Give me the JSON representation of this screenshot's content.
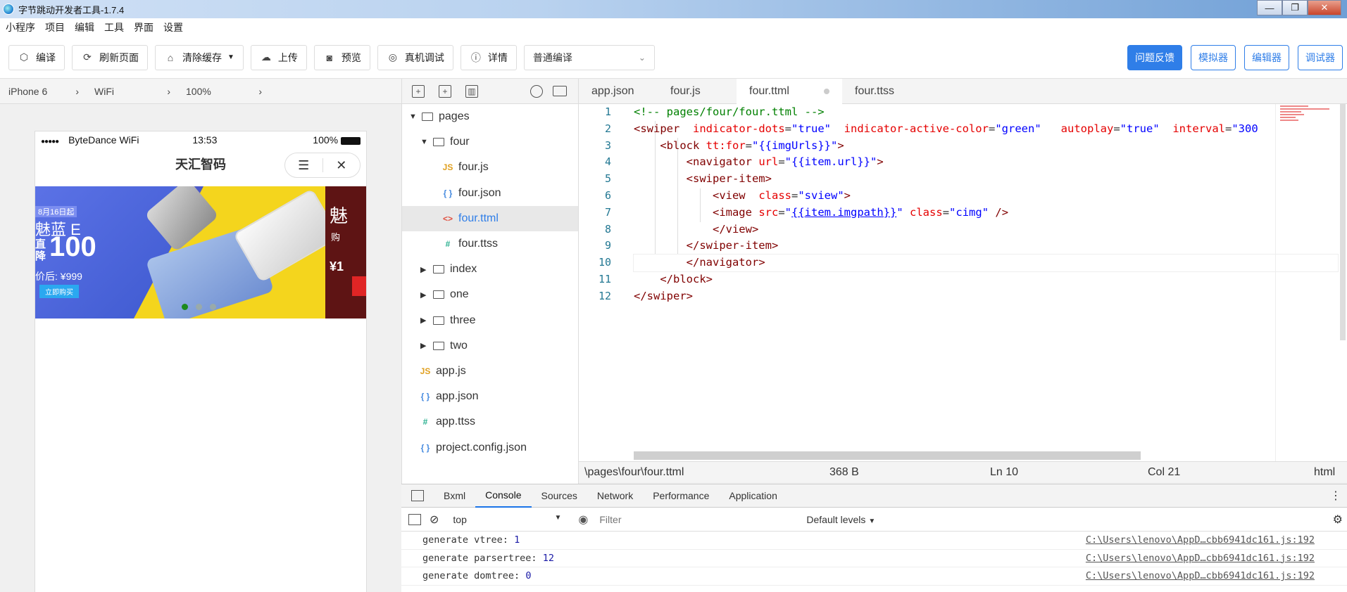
{
  "window": {
    "title": "字节跳动开发者工具-1.7.4",
    "minimize": "—",
    "maximize": "❐",
    "close": "✕"
  },
  "menu": [
    "小程序",
    "项目",
    "编辑",
    "工具",
    "界面",
    "设置"
  ],
  "toolbar": {
    "compile": "编译",
    "refresh": "刷新页面",
    "clear_cache": "清除缓存",
    "upload": "上传",
    "preview": "预览",
    "device_debug": "真机调试",
    "details": "详情",
    "compile_mode": "普通编译",
    "feedback": "问题反馈",
    "simulator": "模拟器",
    "editor": "编辑器",
    "debugger": "调试器"
  },
  "devicebar": {
    "device": "iPhone 6",
    "network": "WiFi",
    "zoom": "100%"
  },
  "phone": {
    "signal": "●●●●●",
    "carrier": "ByteDance WiFi",
    "time": "13:53",
    "battery": "100%",
    "nav_title": "天汇智码",
    "banner": {
      "date": "8月16日起",
      "product": "魅蓝 E",
      "drop": "直降",
      "amount": "100",
      "price": "价后: ¥999",
      "buy": "立即购买",
      "right_brand": "魅",
      "right_buy": "购",
      "right_price": "¥1"
    }
  },
  "filetree": {
    "items": [
      {
        "label": "pages",
        "type": "folder",
        "open": true,
        "level": 0
      },
      {
        "label": "four",
        "type": "folder",
        "open": true,
        "level": 1
      },
      {
        "label": "four.js",
        "type": "js",
        "level": 2
      },
      {
        "label": "four.json",
        "type": "json",
        "level": 2
      },
      {
        "label": "four.ttml",
        "type": "ttml",
        "level": 2,
        "selected": true
      },
      {
        "label": "four.ttss",
        "type": "ttss",
        "level": 2
      },
      {
        "label": "index",
        "type": "folder",
        "open": false,
        "level": 1
      },
      {
        "label": "one",
        "type": "folder",
        "open": false,
        "level": 1
      },
      {
        "label": "three",
        "type": "folder",
        "open": false,
        "level": 1
      },
      {
        "label": "two",
        "type": "folder",
        "open": false,
        "level": 1
      },
      {
        "label": "app.js",
        "type": "js",
        "level": 0
      },
      {
        "label": "app.json",
        "type": "json",
        "level": 0
      },
      {
        "label": "app.ttss",
        "type": "ttss",
        "level": 0
      },
      {
        "label": "project.config.json",
        "type": "json",
        "level": 0
      }
    ]
  },
  "tabs": [
    {
      "label": "app.json",
      "active": false
    },
    {
      "label": "four.js",
      "active": false
    },
    {
      "label": "four.ttml",
      "active": true
    },
    {
      "label": "four.ttss",
      "active": false
    }
  ],
  "editor": {
    "lines": [
      "<!-- pages/four/four.ttml -->",
      "<swiper  indicator-dots=\"true\"  indicator-active-color=\"green\"   autoplay=\"true\"  interval=\"300",
      "    <block tt:for=\"{{imgUrls}}\">",
      "        <navigator url=\"{{item.url}}\">",
      "        <swiper-item>",
      "            <view  class=\"sview\">",
      "            <image src=\"{{item.imgpath}}\" class=\"cimg\" />",
      "            </view>",
      "        </swiper-item>",
      "        </navigator>",
      "    </block>",
      "</swiper>"
    ]
  },
  "statusline": {
    "path": "\\pages\\four\\four.ttml",
    "size": "368 B",
    "line": "Ln 10",
    "col": "Col 21",
    "lang": "html"
  },
  "devtools": {
    "tabs": [
      "Bxml",
      "Console",
      "Sources",
      "Network",
      "Performance",
      "Application"
    ],
    "active_tab": "Console",
    "context": "top",
    "filter_placeholder": "Filter",
    "levels": "Default levels",
    "logs": [
      {
        "text": "generate vtree:",
        "value": "1",
        "source": "C:\\Users\\lenovo\\AppD…cbb6941dc161.js:192"
      },
      {
        "text": "generate parsertree:",
        "value": "12",
        "source": "C:\\Users\\lenovo\\AppD…cbb6941dc161.js:192"
      },
      {
        "text": "generate domtree:",
        "value": "0",
        "source": "C:\\Users\\lenovo\\AppD…cbb6941dc161.js:192"
      }
    ]
  }
}
